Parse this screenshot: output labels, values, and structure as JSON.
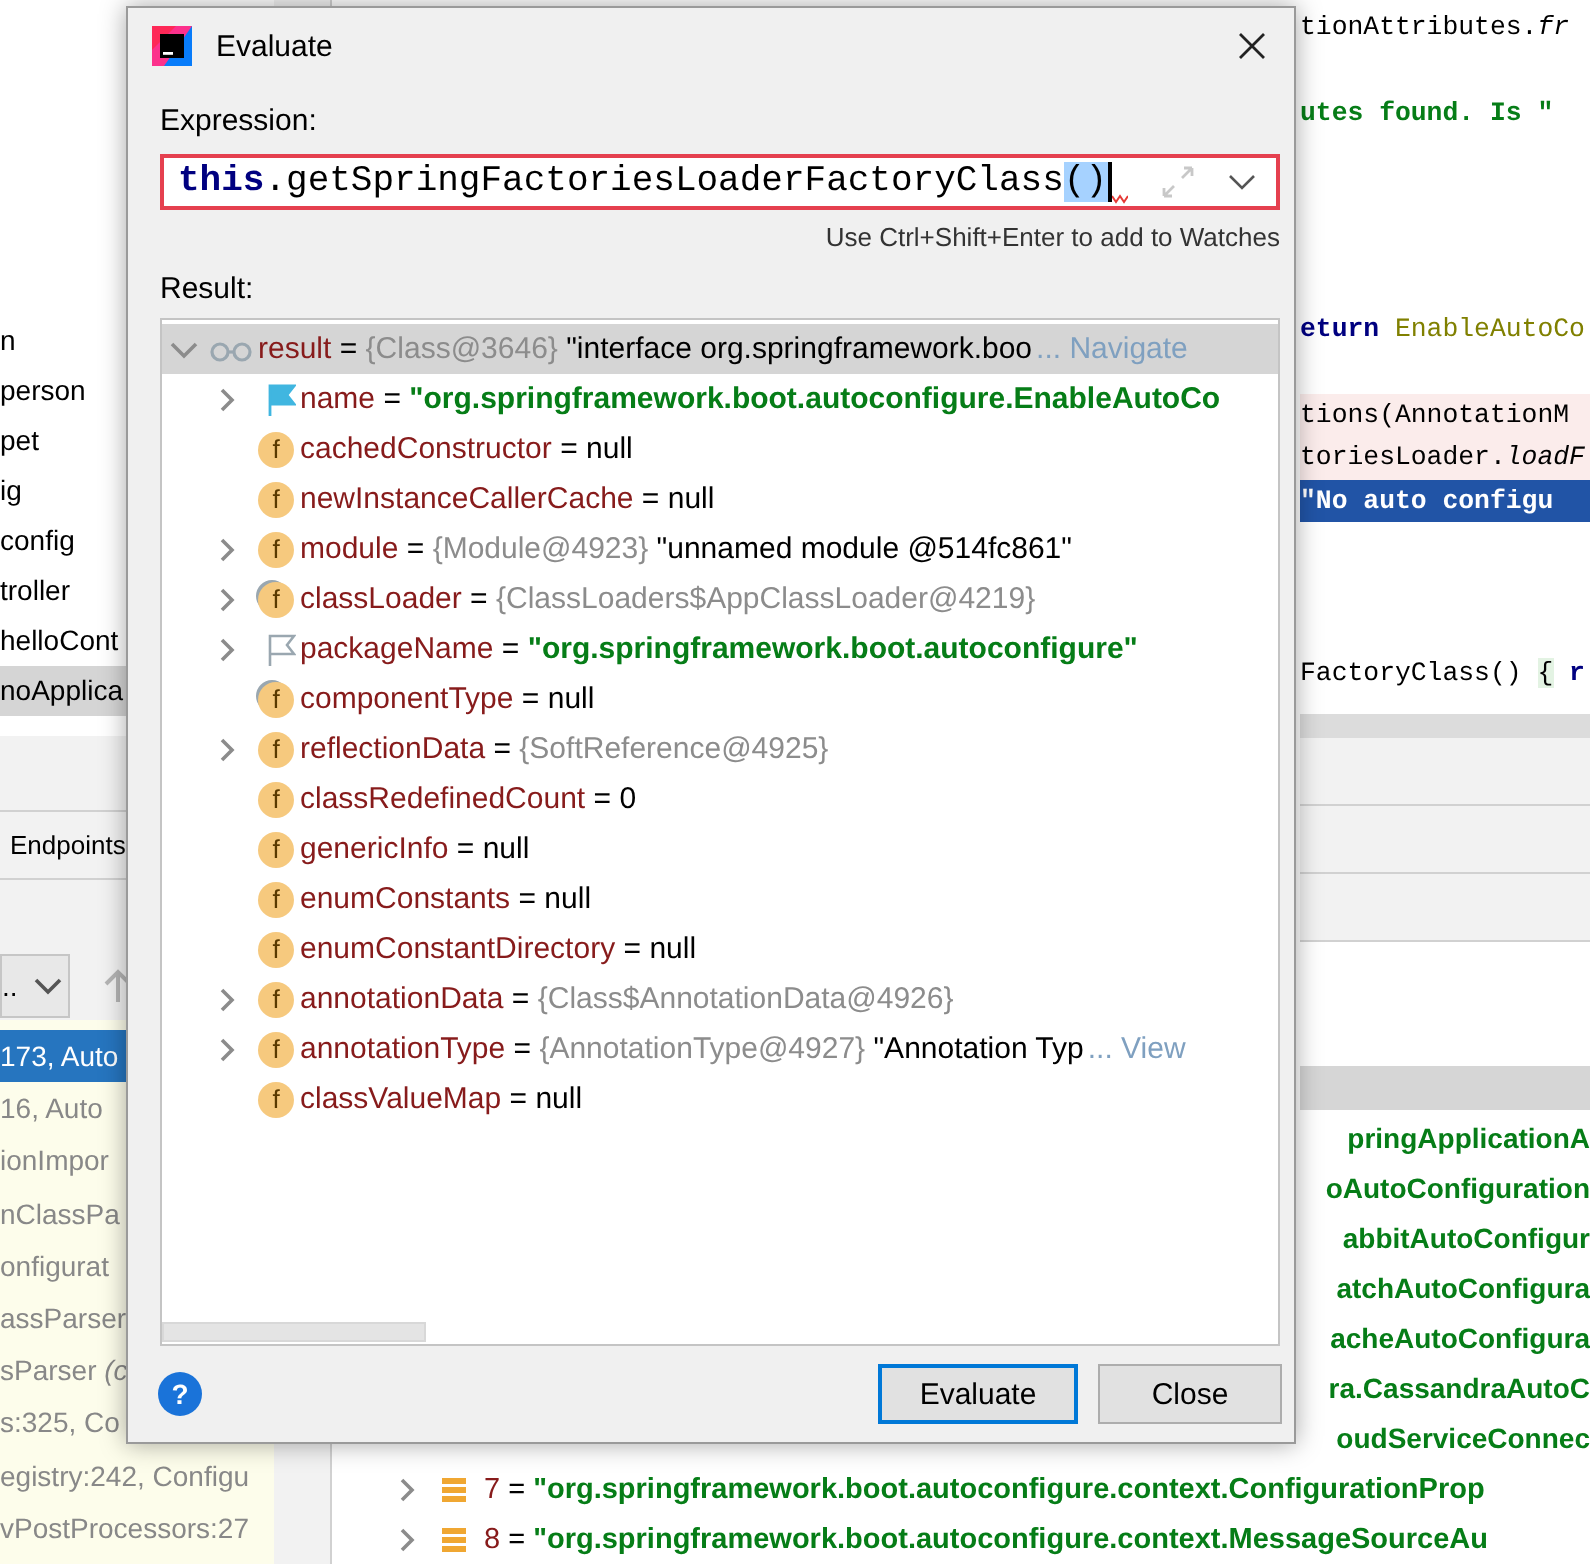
{
  "project_tree": {
    "items": [
      {
        "label": "n",
        "selected": false
      },
      {
        "label": "person",
        "selected": false
      },
      {
        "label": "pet",
        "selected": false
      },
      {
        "label": "ig",
        "selected": false
      },
      {
        "label": "config",
        "selected": false
      },
      {
        "label": "troller",
        "selected": false
      },
      {
        "label": "helloCont",
        "selected": false
      },
      {
        "label": "noApplica",
        "selected": true
      }
    ]
  },
  "debugger": {
    "tab": "Endpoints",
    "thread_selector": "..",
    "frames": [
      {
        "text": "173, Auto",
        "selected": true
      },
      {
        "text": "16, Auto",
        "selected": false
      },
      {
        "text": "ionImpor",
        "selected": false
      },
      {
        "text": "nClassPa",
        "selected": false
      },
      {
        "text": "onfigurat",
        "selected": false
      },
      {
        "text": "assParser",
        "selected": false
      },
      {
        "text": "sParser *(c*",
        "selected": false
      },
      {
        "text": "s:325, Co",
        "selected": false
      },
      {
        "text": "egistry:242, Configu",
        "selected": false
      },
      {
        "text": "vPostProcessors:27",
        "selected": false
      }
    ]
  },
  "editor": {
    "lines": [
      {
        "kind": "plain",
        "tokens": [
          {
            "kind": "text",
            "text": "tionAttributes."
          },
          {
            "kind": "italic",
            "text": "fr"
          }
        ]
      },
      {
        "kind": "blank"
      },
      {
        "kind": "plain",
        "tokens": [
          {
            "kind": "string",
            "text": "utes found. Is \""
          }
        ]
      },
      {
        "kind": "blank"
      },
      {
        "kind": "blank"
      },
      {
        "kind": "blank"
      },
      {
        "kind": "blank"
      },
      {
        "kind": "plain",
        "tokens": [
          {
            "kind": "keyword",
            "text": "eturn "
          },
          {
            "kind": "constant",
            "text": "EnableAutoCo"
          }
        ]
      },
      {
        "kind": "blank"
      },
      {
        "kind": "highlighted",
        "tokens": [
          {
            "kind": "text",
            "text": "tions(AnnotationM"
          }
        ]
      },
      {
        "kind": "highlighted",
        "tokens": [
          {
            "kind": "text",
            "text": "toriesLoader."
          },
          {
            "kind": "italic",
            "text": "loadF"
          }
        ]
      },
      {
        "kind": "execution",
        "tokens": [
          {
            "kind": "string",
            "text": "\"No auto configu"
          }
        ]
      },
      {
        "kind": "blank"
      },
      {
        "kind": "blank"
      },
      {
        "kind": "blank"
      },
      {
        "kind": "plain",
        "tokens": [
          {
            "kind": "text",
            "text": "FactoryClass() "
          },
          {
            "kind": "brace",
            "text": "{"
          },
          {
            "kind": "keyword",
            "text": " r"
          }
        ]
      }
    ]
  },
  "variables": {
    "rows": [
      {
        "kind": "fragment",
        "text": "pringApplicationA"
      },
      {
        "kind": "fragment",
        "text": "oAutoConfiguration"
      },
      {
        "kind": "fragment",
        "text": "abbitAutoConfigur"
      },
      {
        "kind": "fragment",
        "text": "atchAutoConfigura"
      },
      {
        "kind": "fragment",
        "text": "acheAutoConfigura"
      },
      {
        "kind": "fragment",
        "text": "ra.CassandraAutoC"
      },
      {
        "kind": "fragment",
        "text": "oudServiceConnec"
      },
      {
        "kind": "entry",
        "expanded": false,
        "name": "7",
        "sign": "=",
        "value": "\"org.springframework.boot.autoconfigure.context.ConfigurationProp"
      },
      {
        "kind": "entry",
        "expanded": false,
        "name": "8",
        "sign": "=",
        "value": "\"org.springframework.boot.autoconfigure.context.MessageSourceAu"
      }
    ]
  },
  "dialog": {
    "title": "Evaluate",
    "expression_label": "Expression:",
    "expression": {
      "error": true,
      "tokens": [
        {
          "kind": "keyword",
          "text": "this"
        },
        {
          "kind": "text",
          "text": ".getSpringFactoriesLoaderFactoryClass"
        },
        {
          "kind": "selected",
          "text": "()"
        }
      ]
    },
    "hint": "Use Ctrl+Shift+Enter to add to Watches",
    "result_label": "Result:",
    "result_tree": {
      "root": {
        "name": "result",
        "sign": "=",
        "type_ref": "{Class@3646}",
        "value": {
          "kind": "plain",
          "text": "\"interface org.springframework.boo"
        },
        "link": "... Navigate",
        "icon": {
          "kind": "watch"
        },
        "expandable": true,
        "expanded": true,
        "selected": true,
        "children": [
          {
            "name": "name",
            "sign": "=",
            "value": {
              "kind": "string",
              "text": "\"org.springframework.boot.autoconfigure.EnableAutoCo"
            },
            "icon": {
              "kind": "flag"
            },
            "expandable": true,
            "expanded": false,
            "selected": false
          },
          {
            "name": "cachedConstructor",
            "sign": "=",
            "value": {
              "kind": "plain",
              "text": "null"
            },
            "icon": {
              "kind": "field",
              "glyph": "f"
            },
            "expandable": false,
            "selected": false
          },
          {
            "name": "newInstanceCallerCache",
            "sign": "=",
            "value": {
              "kind": "plain",
              "text": "null"
            },
            "icon": {
              "kind": "field",
              "glyph": "f"
            },
            "expandable": false,
            "selected": false
          },
          {
            "name": "module",
            "sign": "=",
            "type_ref": "{Module@4923}",
            "value": {
              "kind": "plain",
              "text": "\"unnamed module @514fc861\""
            },
            "icon": {
              "kind": "field",
              "glyph": "f"
            },
            "expandable": true,
            "expanded": false,
            "selected": false
          },
          {
            "name": "classLoader",
            "sign": "=",
            "type_ref": "{ClassLoaders$AppClassLoader@4219}",
            "icon": {
              "kind": "field_marked",
              "glyph": "f"
            },
            "expandable": true,
            "expanded": false,
            "selected": false
          },
          {
            "name": "packageName",
            "sign": "=",
            "value": {
              "kind": "string",
              "text": "\"org.springframework.boot.autoconfigure\""
            },
            "icon": {
              "kind": "flag_outline"
            },
            "expandable": true,
            "expanded": false,
            "selected": false
          },
          {
            "name": "componentType",
            "sign": "=",
            "value": {
              "kind": "plain",
              "text": "null"
            },
            "icon": {
              "kind": "field_marked",
              "glyph": "f"
            },
            "expandable": false,
            "selected": false
          },
          {
            "name": "reflectionData",
            "sign": "=",
            "type_ref": "{SoftReference@4925}",
            "icon": {
              "kind": "field",
              "glyph": "f"
            },
            "expandable": true,
            "expanded": false,
            "selected": false
          },
          {
            "name": "classRedefinedCount",
            "sign": "=",
            "value": {
              "kind": "plain",
              "text": "0"
            },
            "icon": {
              "kind": "field",
              "glyph": "f"
            },
            "expandable": false,
            "selected": false
          },
          {
            "name": "genericInfo",
            "sign": "=",
            "value": {
              "kind": "plain",
              "text": "null"
            },
            "icon": {
              "kind": "field",
              "glyph": "f"
            },
            "expandable": false,
            "selected": false
          },
          {
            "name": "enumConstants",
            "sign": "=",
            "value": {
              "kind": "plain",
              "text": "null"
            },
            "icon": {
              "kind": "field",
              "glyph": "f"
            },
            "expandable": false,
            "selected": false
          },
          {
            "name": "enumConstantDirectory",
            "sign": "=",
            "value": {
              "kind": "plain",
              "text": "null"
            },
            "icon": {
              "kind": "field",
              "glyph": "f"
            },
            "expandable": false,
            "selected": false
          },
          {
            "name": "annotationData",
            "sign": "=",
            "type_ref": "{Class$AnnotationData@4926}",
            "icon": {
              "kind": "field",
              "glyph": "f"
            },
            "expandable": true,
            "expanded": false,
            "selected": false
          },
          {
            "name": "annotationType",
            "sign": "=",
            "type_ref": "{AnnotationType@4927}",
            "value": {
              "kind": "plain",
              "text": "\"Annotation Typ"
            },
            "link": "... View",
            "icon": {
              "kind": "field",
              "glyph": "f"
            },
            "expandable": true,
            "expanded": false,
            "selected": false
          },
          {
            "name": "classValueMap",
            "sign": "=",
            "value": {
              "kind": "plain",
              "text": "null"
            },
            "icon": {
              "kind": "field",
              "glyph": "f"
            },
            "expandable": false,
            "selected": false
          }
        ]
      }
    },
    "help_button": "?",
    "buttons": [
      {
        "label": "Evaluate",
        "default": true
      },
      {
        "label": "Close",
        "default": false
      }
    ]
  }
}
